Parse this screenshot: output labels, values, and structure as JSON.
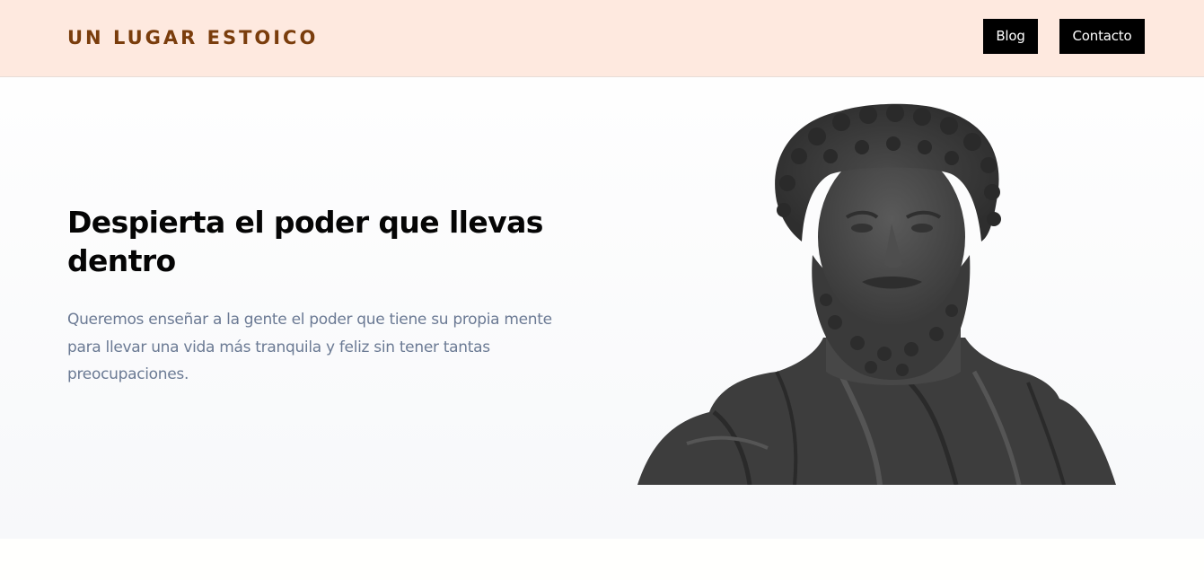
{
  "header": {
    "logo": "UN LUGAR ESTOICO",
    "nav": {
      "blog_label": "Blog",
      "contact_label": "Contacto"
    }
  },
  "hero": {
    "headline": "Despierta el poder que llevas dentro",
    "subtext": "Queremos enseñar a la gente el poder que tiene su propia mente para llevar una vida más tranquila y feliz sin tener tantas preocupaciones."
  },
  "colors": {
    "header_bg": "#fee9df",
    "logo": "#7a3d0c",
    "nav_button_bg": "#000000",
    "headline": "#050505",
    "subtext": "#6b7a94"
  },
  "icons": {
    "hero_image": "marble-bust-image"
  }
}
